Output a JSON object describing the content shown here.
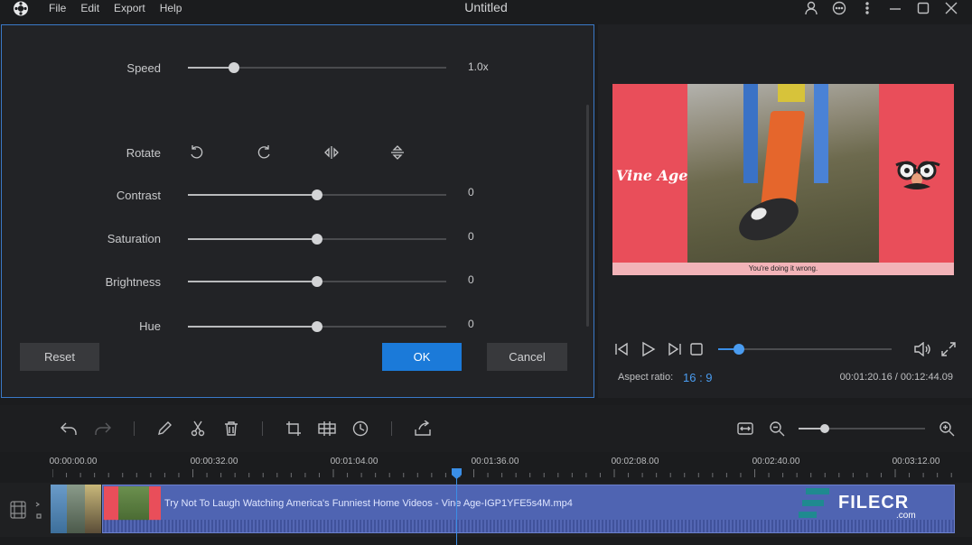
{
  "titlebar": {
    "title": "Untitled",
    "menu": [
      "File",
      "Edit",
      "Export",
      "Help"
    ],
    "icons": [
      "app-logo-icon",
      "account-icon",
      "feedback-icon",
      "more-icon",
      "minimize-icon",
      "maximize-icon",
      "close-icon"
    ]
  },
  "edit_panel": {
    "speed": {
      "label": "Speed",
      "value": "1.0x",
      "level": 0.18
    },
    "rotate": {
      "label": "Rotate",
      "buttons": [
        "rotate-left-icon",
        "rotate-right-icon",
        "flip-horizontal-icon",
        "flip-vertical-icon"
      ]
    },
    "contrast": {
      "label": "Contrast",
      "value": "0",
      "level": 0.5
    },
    "saturation": {
      "label": "Saturation",
      "value": "0",
      "level": 0.5
    },
    "brightness": {
      "label": "Brightness",
      "value": "0",
      "level": 0.5
    },
    "hue": {
      "label": "Hue",
      "value": "0",
      "level": 0.5
    },
    "reset_label": "Reset",
    "ok_label": "OK",
    "cancel_label": "Cancel"
  },
  "preview": {
    "video_text": "Vine Age",
    "subtitle": "You're doing it wrong.",
    "progress": 0.12,
    "aspect_label": "Aspect ratio:",
    "aspect_value": "16 : 9",
    "time": "00:01:20.16 / 00:12:44.09",
    "controls": [
      "prev-frame-icon",
      "play-icon",
      "next-frame-icon",
      "stop-icon",
      "volume-icon",
      "fullscreen-icon"
    ]
  },
  "toolbar": {
    "icons": [
      "undo-icon",
      "redo-icon",
      "edit-icon",
      "cut-icon",
      "delete-icon",
      "crop-icon",
      "mosaic-icon",
      "duration-icon",
      "export-icon",
      "fit-icon",
      "zoom-out-icon",
      "zoom-in-icon"
    ],
    "zoom_level": 0.21
  },
  "timeline": {
    "ticks": [
      "00:00:00.00",
      "00:00:32.00",
      "00:01:04.00",
      "00:01:36.00",
      "00:02:08.00",
      "00:02:40.00",
      "00:03:12.00"
    ],
    "clip_name": "Try Not To Laugh Watching America's Funniest Home Videos - Vine Age-IGP1YFE5s4M.mp4"
  },
  "watermark": {
    "text": "FILECR",
    "suffix": ".com"
  },
  "colors": {
    "accent": "#1b7ad9",
    "clip": "#4f64b2",
    "video_bg": "#e94e5a"
  }
}
